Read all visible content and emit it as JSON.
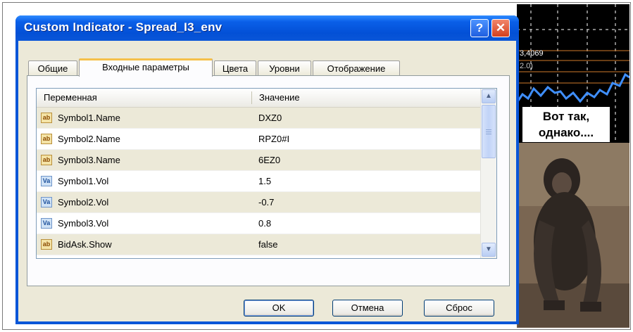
{
  "window": {
    "title": "Custom Indicator - Spread_I3_env",
    "help_glyph": "?",
    "close_glyph": "✕"
  },
  "tabs": [
    {
      "label": "Общие",
      "active": false
    },
    {
      "label": "Входные параметры",
      "active": true
    },
    {
      "label": "Цвета",
      "active": false
    },
    {
      "label": "Уровни",
      "active": false
    },
    {
      "label": "Отображение",
      "active": false
    }
  ],
  "grid": {
    "columns": [
      "Переменная",
      "Значение"
    ],
    "rows": [
      {
        "icon": "ab",
        "icon_name": "string-type-icon",
        "name": "Symbol1.Name",
        "value": "DXZ0"
      },
      {
        "icon": "ab",
        "icon_name": "string-type-icon",
        "name": "Symbol2.Name",
        "value": "RPZ0#I"
      },
      {
        "icon": "ab",
        "icon_name": "string-type-icon",
        "name": "Symbol3.Name",
        "value": "6EZ0"
      },
      {
        "icon": "Va",
        "icon_name": "double-type-icon",
        "name": "Symbol1.Vol",
        "value": "1.5"
      },
      {
        "icon": "Va",
        "icon_name": "double-type-icon",
        "name": "Symbol2.Vol",
        "value": "-0.7"
      },
      {
        "icon": "Va",
        "icon_name": "double-type-icon",
        "name": "Symbol3.Vol",
        "value": "0.8"
      },
      {
        "icon": "ab",
        "icon_name": "bool-type-icon",
        "name": "BidAsk.Show",
        "value": "false"
      }
    ]
  },
  "buttons": {
    "ok": "OK",
    "cancel": "Отмена",
    "reset": "Сброс"
  },
  "background": {
    "price_label": "3,4069",
    "sub_label": "2.0)",
    "speech_line1": "Вот так,",
    "speech_line2": "однако...."
  },
  "colors": {
    "titlebar": "#0a56d8",
    "dialog_face": "#ece9d8",
    "alt_row": "#ece9d8",
    "chart_bg": "#000000",
    "chart_line": "#3f8fff"
  }
}
